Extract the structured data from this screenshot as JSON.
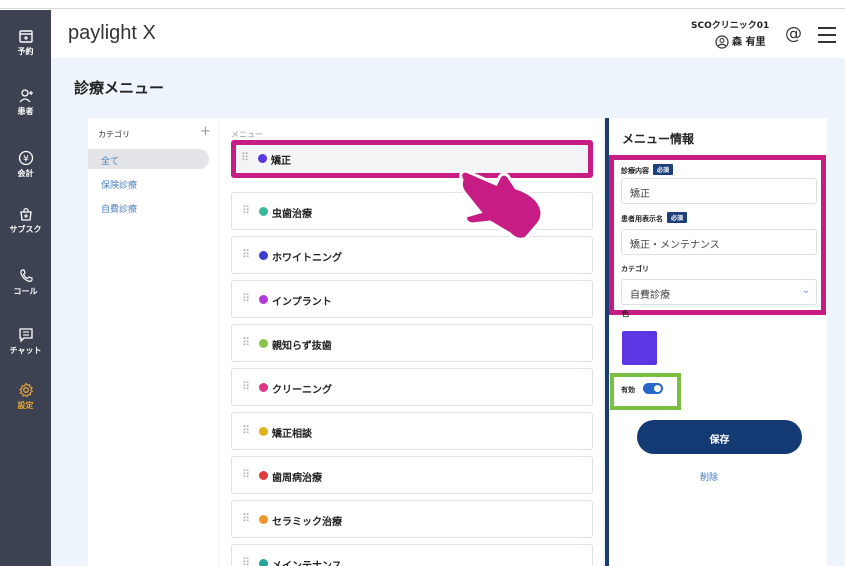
{
  "app": {
    "logo": "paylight X",
    "clinic_name": "SCOクリニック01",
    "user_name": "森 有里"
  },
  "sidebar": {
    "items": [
      {
        "label": "予約",
        "icon": "calendar-plus-icon"
      },
      {
        "label": "患者",
        "icon": "user-add-icon"
      },
      {
        "label": "会計",
        "icon": "yen-icon"
      },
      {
        "label": "サブスク",
        "icon": "bag-plus-icon"
      },
      {
        "label": "コール",
        "icon": "phone-icon"
      },
      {
        "label": "チャット",
        "icon": "chat-icon"
      },
      {
        "label": "設定",
        "icon": "gear-icon",
        "active": true
      }
    ]
  },
  "page": {
    "title": "診療メニュー"
  },
  "categories": {
    "header": "カテゴリ",
    "add": "+",
    "items": [
      "全て",
      "保険診療",
      "自費診療"
    ],
    "selected": "全て"
  },
  "menu": {
    "header": "メニュー",
    "items": [
      {
        "name": "矯正",
        "color": "#5a37e3"
      },
      {
        "name": "虫歯治療",
        "color": "#3bb89a"
      },
      {
        "name": "ホワイトニング",
        "color": "#3b3bd0"
      },
      {
        "name": "インプラント",
        "color": "#b23bd8"
      },
      {
        "name": "親知らず抜歯",
        "color": "#8bc34a"
      },
      {
        "name": "クリーニング",
        "color": "#e0348a"
      },
      {
        "name": "矯正相談",
        "color": "#e0b21a"
      },
      {
        "name": "歯周病治療",
        "color": "#e23a3a"
      },
      {
        "name": "セラミック治療",
        "color": "#f0962a"
      },
      {
        "name": "メインテナンス",
        "color": "#26a69a"
      }
    ],
    "selected": "矯正"
  },
  "info": {
    "title": "メニュー情報",
    "content_label": "診療内容",
    "content_value": "矯正",
    "required_badge": "必須",
    "patient_label": "患者用表示名",
    "patient_value": "矯正・メンテナンス",
    "category_label": "カテゴリ",
    "category_value": "自費診療",
    "color_label": "色",
    "color_value": "#5a37e3",
    "active_label": "有効",
    "active": true,
    "save_label": "保存",
    "delete_label": "削除"
  },
  "colors": {
    "sidebar_bg": "#3c4251",
    "accent_navy": "#143a73",
    "highlight_magenta": "#c71c84",
    "highlight_green": "#7ac143"
  }
}
